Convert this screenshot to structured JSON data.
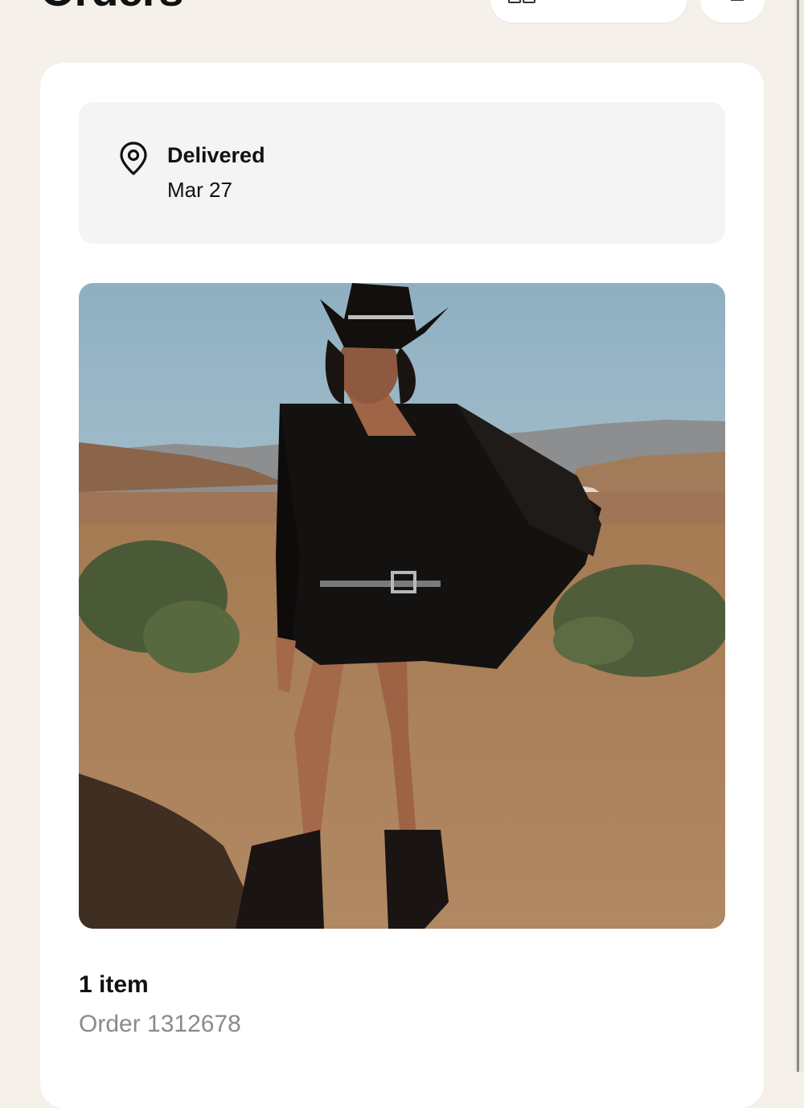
{
  "header": {
    "title": "Orders",
    "view_toggle_label": "",
    "more_icon": "more-icon"
  },
  "order": {
    "status": {
      "icon": "location-pin-icon",
      "title": "Delivered",
      "date": "Mar 27"
    },
    "image": {
      "subject": "product-photo"
    },
    "item_count": "1 item",
    "order_number": "Order 1312678"
  },
  "colors": {
    "background": "#f5f0ea",
    "card": "#ffffff",
    "status_box": "#f4f4f4",
    "muted_text": "#8a8a8a"
  }
}
